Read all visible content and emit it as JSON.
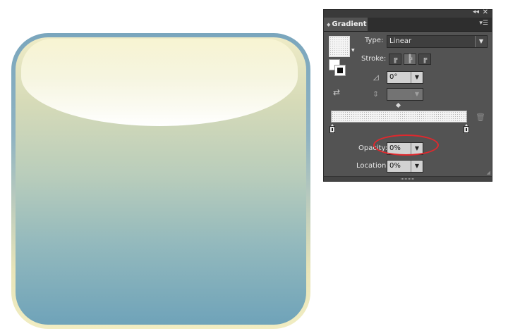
{
  "panel": {
    "tab_label": "Gradient",
    "type_label": "Type:",
    "type_value": "Linear",
    "stroke_label": "Stroke:",
    "angle_value": "0°",
    "aspect_value": "",
    "opacity_label": "Opacity:",
    "opacity_value": "0%",
    "location_label": "Location:",
    "location_value": "0%"
  },
  "icons": {
    "collapse": "double-chevron-left-icon",
    "close": "close-icon",
    "menu": "panel-menu-icon",
    "angle": "angle-icon",
    "aspect_ratio": "aspect-ratio-icon",
    "delete_stop": "trash-icon"
  },
  "colors": {
    "panel_bg": "#535353",
    "highlight": "#e0282d",
    "art_border_top": "#7aa6bd",
    "art_fill_bottom": "#6fa3b9",
    "art_fill_top": "#eeebc6"
  }
}
